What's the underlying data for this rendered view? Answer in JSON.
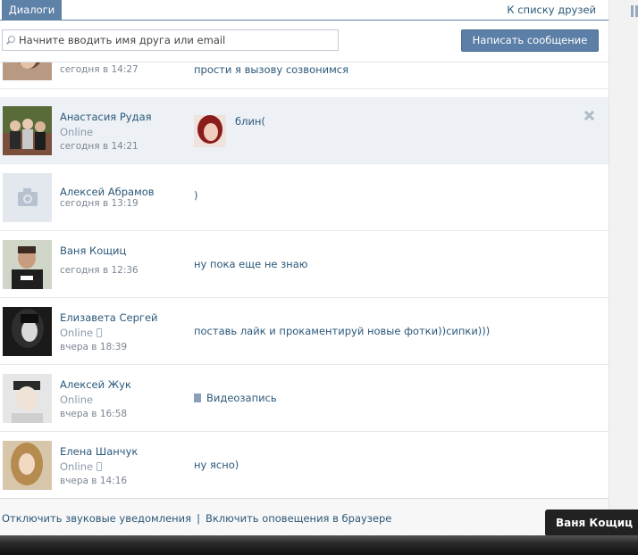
{
  "header": {
    "tab_label": "Диалоги",
    "friends_link": "К списку друзей"
  },
  "search": {
    "placeholder": "Начните вводить имя друга или email",
    "write_button": "Написать сообщение"
  },
  "dialogs": [
    {
      "name": "",
      "status": "",
      "time": "сегодня в 14:27",
      "message": "прости я вызову созвонимся"
    },
    {
      "name": "Анастасия Рудая",
      "status": "Online",
      "time": "сегодня в 14:21",
      "message": "блин("
    },
    {
      "name": "Алексей Абрамов",
      "status": "",
      "time": "сегодня в 13:19",
      "message": ")"
    },
    {
      "name": "Ваня Кощиц",
      "status": "",
      "time": "сегодня в 12:36",
      "message": "ну пока еще не знаю"
    },
    {
      "name": "Елизавета Сергей",
      "status": "Online",
      "time": "вчера в 18:39",
      "message": "поставь лайк и прокаментируй новые фотки))сипки)))"
    },
    {
      "name": "Алексей Жук",
      "status": "Online",
      "time": "вчера в 16:58",
      "message": "Видеозапись"
    },
    {
      "name": "Елена Шанчук",
      "status": "Online",
      "time": "вчера в 14:16",
      "message": "ну ясно)"
    }
  ],
  "footer": {
    "sound_toggle": "Отключить звуковые уведомления",
    "separator": "|",
    "browser_notify": "Включить оповещения в браузере"
  },
  "toast": {
    "name": "Ваня Кощиц"
  },
  "colors": {
    "accent": "#5e81a8",
    "link": "#2b587a",
    "muted": "#8c9aab"
  }
}
